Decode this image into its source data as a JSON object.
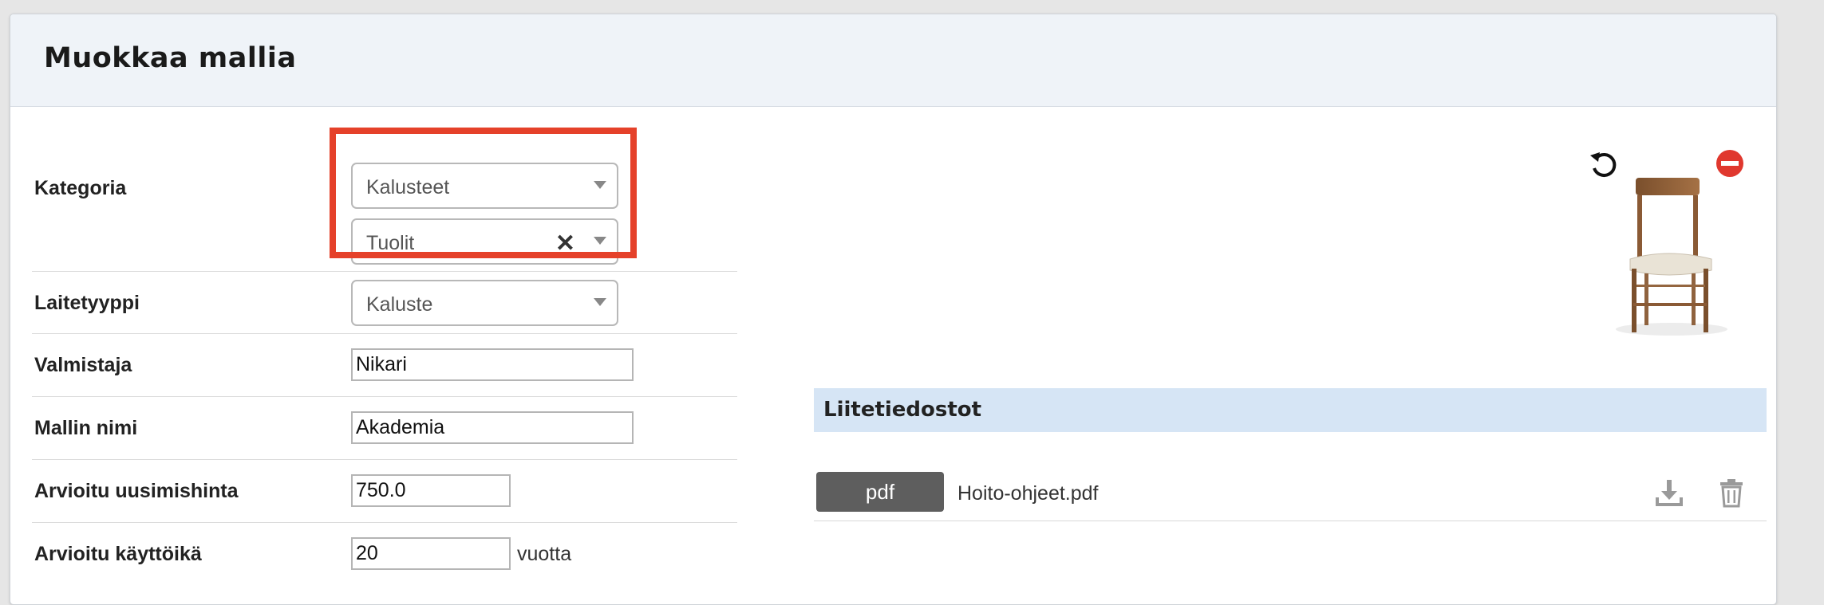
{
  "header": {
    "title": "Muokkaa mallia"
  },
  "form": {
    "category_label": "Kategoria",
    "category_main": "Kalusteet",
    "category_sub": "Tuolit",
    "device_type_label": "Laitetyyppi",
    "device_type_value": "Kaluste",
    "manufacturer_label": "Valmistaja",
    "manufacturer_value": "Nikari",
    "model_name_label": "Mallin nimi",
    "model_name_value": "Akademia",
    "replacement_price_label": "Arvioitu uusimishinta",
    "replacement_price_value": "750.0",
    "lifetime_label": "Arvioitu käyttöikä",
    "lifetime_value": "20",
    "lifetime_unit": "vuotta"
  },
  "attachments": {
    "title": "Liitetiedostot",
    "files": [
      {
        "type": "pdf",
        "name": "Hoito-ohjeet.pdf"
      }
    ]
  },
  "icons": {
    "rotate": "rotate-icon",
    "remove": "remove-icon",
    "clear": "clear-icon",
    "download": "download-icon",
    "trash": "trash-icon"
  },
  "colors": {
    "highlight": "#e5412a",
    "attach_header": "#d6e5f5",
    "pdf_button": "#5e5e5e",
    "remove": "#e0382e"
  }
}
